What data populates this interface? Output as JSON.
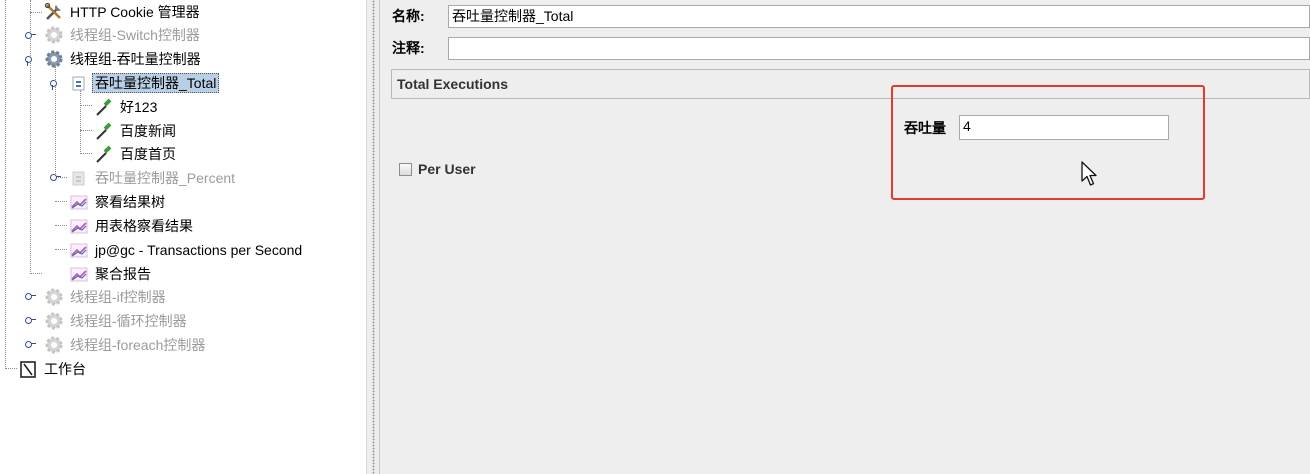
{
  "tree": {
    "items": [
      {
        "label": "HTTP Cookie 管理器",
        "icon": "wrench-scissors-icon"
      },
      {
        "label": "线程组-Switch控制器",
        "icon": "gear-icon"
      },
      {
        "label": "线程组-吞吐量控制器",
        "icon": "gear-icon"
      },
      {
        "label": "吞吐量控制器_Total",
        "icon": "controller-icon"
      },
      {
        "label": "好123",
        "icon": "pipette-icon"
      },
      {
        "label": "百度新闻",
        "icon": "pipette-icon"
      },
      {
        "label": "百度首页",
        "icon": "pipette-icon"
      },
      {
        "label": "吞吐量控制器_Percent",
        "icon": "controller-icon"
      },
      {
        "label": "察看结果树",
        "icon": "graph-icon"
      },
      {
        "label": "用表格察看结果",
        "icon": "graph-icon"
      },
      {
        "label": "jp@gc - Transactions per Second",
        "icon": "graph-icon"
      },
      {
        "label": "聚合报告",
        "icon": "graph-icon"
      },
      {
        "label": "线程组-if控制器",
        "icon": "gear-icon"
      },
      {
        "label": "线程组-循环控制器",
        "icon": "gear-icon"
      },
      {
        "label": "线程组-foreach控制器",
        "icon": "gear-icon"
      },
      {
        "label": "工作台",
        "icon": "workbench-icon"
      }
    ]
  },
  "editor": {
    "name_label": "名称:",
    "name_value": "吞吐量控制器_Total",
    "comment_label": "注释:",
    "comment_value": "",
    "mode_value": "Total Executions",
    "per_user_label": "Per User",
    "per_user_checked": false,
    "throughput_label": "吞吐量",
    "throughput_value": "4"
  },
  "colors": {
    "selection": "#b9cfe6",
    "highlight_box": "#e23a2e",
    "panel_bg": "#eeeeee",
    "disabled_text": "#9b9b9b"
  }
}
